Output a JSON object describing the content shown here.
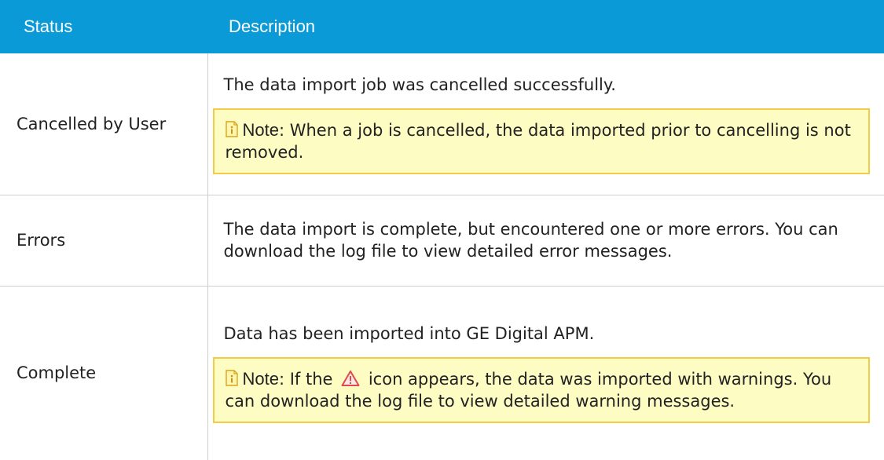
{
  "table": {
    "headers": {
      "status": "Status",
      "description": "Description"
    },
    "rows": [
      {
        "status": "Cancelled by User",
        "description": "The data import job was cancelled successfully.",
        "note": {
          "label": "Note",
          "text": ": When a job is cancelled, the data imported prior to cancelling is not removed."
        }
      },
      {
        "status": "Errors",
        "description": "The data import is complete, but encountered one or more errors. You can download the log file to view detailed error messages."
      },
      {
        "status": "Complete",
        "description": "Data has been imported into GE Digital APM.",
        "note": {
          "label": "Note",
          "text_before_icon": ": If the",
          "icon": "warning-icon",
          "text_after_icon": "icon appears, the data was imported with warnings. You can download the log file to view detailed warning messages."
        }
      }
    ]
  },
  "colors": {
    "header_background": "#0a9ad7",
    "note_background": "#fdfdc3",
    "note_border": "#f2cb48",
    "warning_icon": "#e04a4a"
  }
}
